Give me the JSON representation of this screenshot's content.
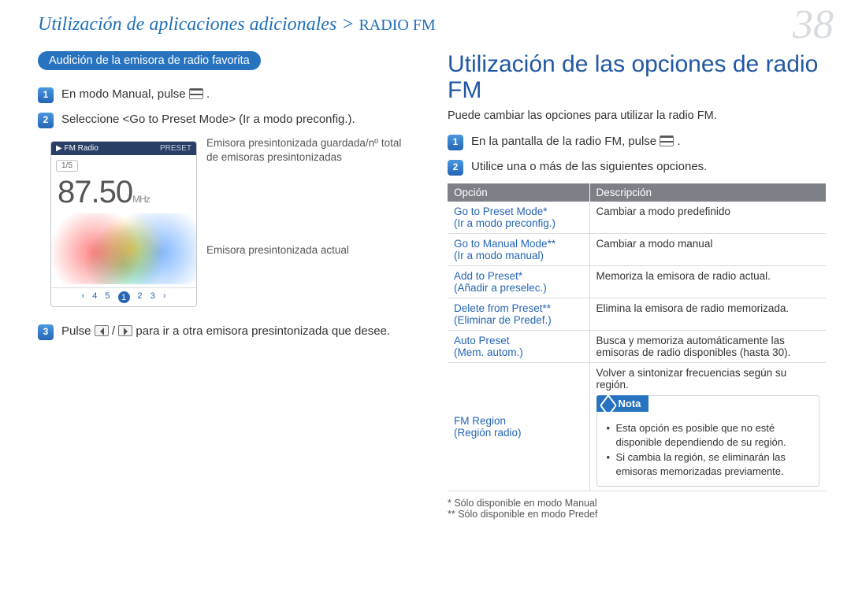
{
  "page_number": "38",
  "breadcrumb": {
    "main": "Utilización de aplicaciones adicionales >",
    "section": " RADIO FM"
  },
  "left": {
    "pill": "Audición de la emisora de radio favorita",
    "step1": "En modo Manual, pulse ",
    "step1_tail": ".",
    "step2": "Seleccione <Go to Preset Mode> (Ir a modo preconfig.).",
    "callout_top": "Emisora presintonizada guardada/nº total de emisoras presintonizadas",
    "callout_bot": "Emisora presintonizada actual",
    "step3_a": "Pulse ",
    "step3_b": "/",
    "step3_c": " para ir a otra emisora presintonizada que desee.",
    "device": {
      "title": "FM Radio",
      "preset": "PRESET",
      "ratio": "1/5",
      "freq": "87.50",
      "mhz": "MHz",
      "presets": [
        "‹",
        "4",
        "5",
        "1",
        "2",
        "3",
        "›"
      ]
    }
  },
  "right": {
    "heading": "Utilización de las opciones de radio FM",
    "sub": "Puede cambiar las opciones para utilizar la radio FM.",
    "step1": "En la pantalla de la radio FM, pulse ",
    "step1_tail": ".",
    "step2": "Utilice una o más de las siguientes opciones.",
    "table": {
      "h1": "Opción",
      "h2": "Descripción",
      "rows": [
        {
          "opt_en": "Go to Preset Mode*",
          "opt_es": "(Ir a modo preconfig.)",
          "desc": "Cambiar a modo predefinido"
        },
        {
          "opt_en": "Go to Manual Mode**",
          "opt_es": "(Ir a modo manual)",
          "desc": "Cambiar a modo manual"
        },
        {
          "opt_en": "Add to Preset*",
          "opt_es": "(Añadir a preselec.)",
          "desc": "Memoriza la emisora de radio actual."
        },
        {
          "opt_en": "Delete from Preset**",
          "opt_es": "(Eliminar de Predef.)",
          "desc": "Elimina la emisora de radio memorizada."
        },
        {
          "opt_en": "Auto Preset",
          "opt_es": "(Mem. autom.)",
          "desc": "Busca y memoriza automáticamente las emisoras de radio disponibles (hasta 30)."
        }
      ],
      "region": {
        "opt_en": "FM Region",
        "opt_es": "(Región radio)",
        "desc": "Volver a sintonizar frecuencias según su región."
      },
      "note_label": "Nota",
      "notes": [
        "Esta opción es posible que no esté disponible dependiendo de su región.",
        "Si cambia la región, se eliminarán las emisoras memorizadas previamente."
      ]
    },
    "foot1": "* Sólo disponible en modo Manual",
    "foot2": "** Sólo disponible en modo Predef"
  }
}
